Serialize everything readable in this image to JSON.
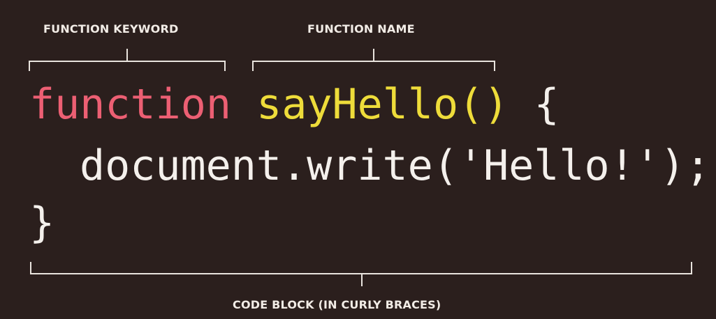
{
  "labels": {
    "function_keyword": "FUNCTION KEYWORD",
    "function_name": "FUNCTION NAME",
    "code_block": "CODE BLOCK (IN CURLY BRACES)"
  },
  "code": {
    "line1": {
      "keyword": "function",
      "space": " ",
      "name": "sayHello()",
      "brace_open": " {"
    },
    "line2": "document.write('Hello!');",
    "line3": "}"
  },
  "colors": {
    "background": "#2b1f1d",
    "keyword": "#ec5f73",
    "function_name": "#eedc3a",
    "text": "#f4f0ec"
  }
}
